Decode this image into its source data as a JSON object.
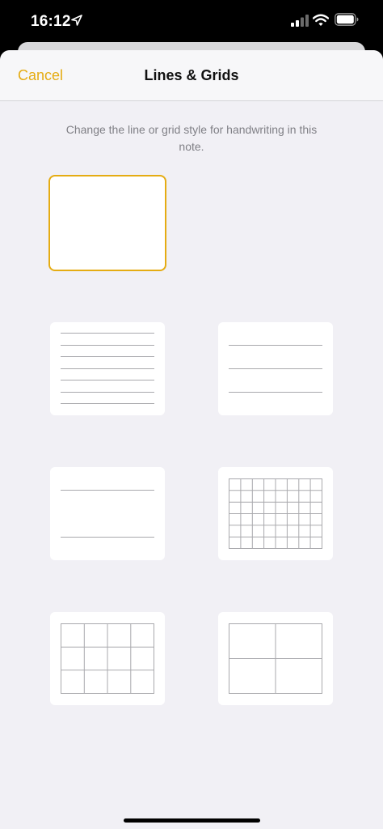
{
  "status_bar": {
    "time": "16:12",
    "icons": [
      "location-arrow-icon",
      "cellular-signal-icon",
      "wifi-icon",
      "battery-icon"
    ]
  },
  "nav": {
    "cancel_label": "Cancel",
    "title": "Lines & Grids"
  },
  "description": "Change the line or grid style for handwriting in this note.",
  "colors": {
    "accent": "#e5ac13",
    "background": "#f1f0f5",
    "line": "#a9a9ad"
  },
  "options": [
    {
      "name": "blank",
      "selected": true
    },
    {
      "name": "narrow-lines",
      "selected": false
    },
    {
      "name": "wide-lines",
      "selected": false
    },
    {
      "name": "extra-wide-lines",
      "selected": false
    },
    {
      "name": "small-grid",
      "selected": false
    },
    {
      "name": "medium-grid",
      "selected": false
    },
    {
      "name": "large-grid",
      "selected": false
    }
  ]
}
